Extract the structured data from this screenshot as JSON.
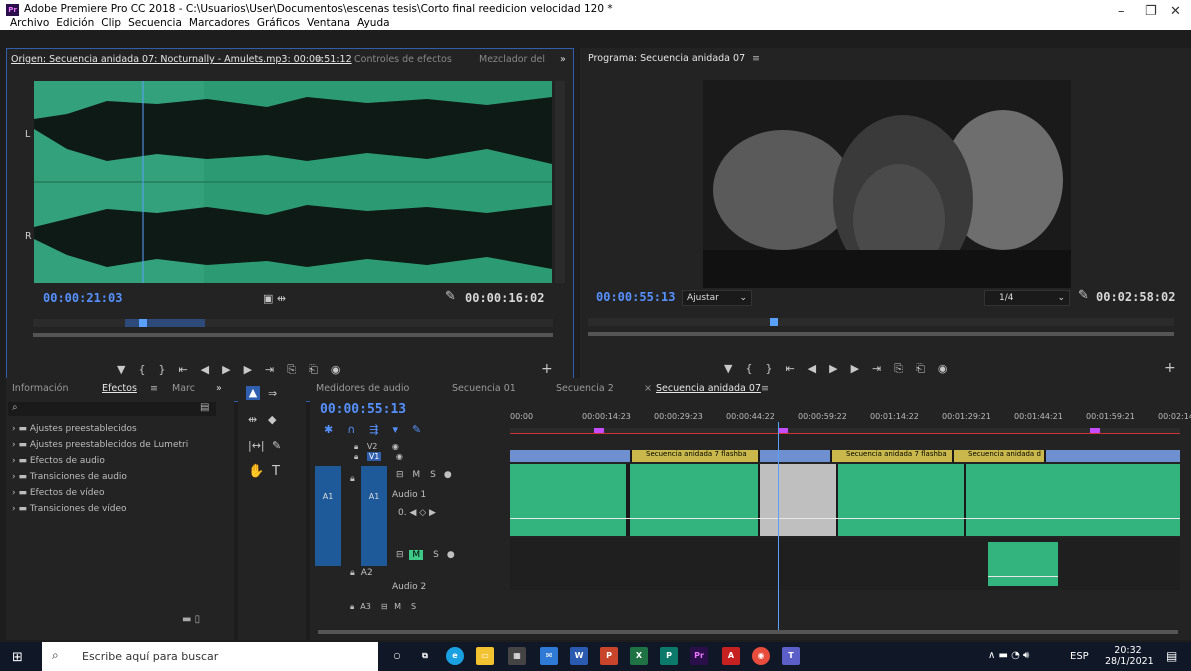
{
  "window": {
    "title": "Adobe Premiere Pro CC 2018 - C:\\Usuarios\\User\\Documentos\\escenas tesis\\Corto final reedicion velocidad 120 *",
    "minimize": "–",
    "maximize": "❐",
    "close": "✕"
  },
  "menu": [
    "Archivo",
    "Edición",
    "Clip",
    "Secuencia",
    "Marcadores",
    "Gráficos",
    "Ventana",
    "Ayuda"
  ],
  "source": {
    "tab_active": "Origen: Secuencia anidada 07: Nocturnally - Amulets.mp3: 00:00:51:12",
    "tab_menu": "≡",
    "tab2": "Controles de efectos",
    "tab3": "Mezclador del",
    "more": "»",
    "channel_L": "L",
    "channel_R": "R",
    "timecode": "00:00:21:03",
    "duration": "00:00:16:02",
    "wrench": "🔧"
  },
  "program": {
    "tab": "Programa: Secuencia anidada 07",
    "tab_menu": "≡",
    "timecode": "00:00:55:13",
    "fit": "Ajustar",
    "resolution": "1/4",
    "duration": "00:02:58:02"
  },
  "project": {
    "tab1": "Información",
    "tab2": "Efectos",
    "tab2_menu": "≡",
    "tab3": "Marc",
    "more": "»",
    "folders": [
      "Ajustes preestablecidos",
      "Ajustes preestablecidos de Lumetri",
      "Efectos de audio",
      "Transiciones de audio",
      "Efectos de vídeo",
      "Transiciones de vídeo"
    ]
  },
  "timeline": {
    "tabs": [
      "Medidores de audio",
      "Secuencia 01",
      "Secuencia 2"
    ],
    "active_tab": "Secuencia anidada 07",
    "close": "×",
    "tab_menu": "≡",
    "timecode": "00:00:55:13",
    "ruler": [
      "00:00",
      "00:00:14:23",
      "00:00:29:23",
      "00:00:44:22",
      "00:00:59:22",
      "00:01:14:22",
      "00:01:29:21",
      "00:01:44:21",
      "00:01:59:21",
      "00:02:14:"
    ],
    "tracks": {
      "v2": "V2",
      "v1": "V1",
      "a1_src": "A1",
      "a1": "A1",
      "a1_name": "Audio 1",
      "a2": "A2",
      "a2_name": "Audio 2",
      "a3": "A3",
      "m": "M",
      "s": "S"
    },
    "clips": [
      "Secuencia anidada 7 flashba",
      "Secuencia anidada 7 flashba",
      "Secuencia anidada d"
    ],
    "fx": "fx"
  },
  "taskbar": {
    "search": "Escribe aquí para buscar",
    "lang": "ESP",
    "time": "20:32",
    "date": "28/1/2021"
  }
}
